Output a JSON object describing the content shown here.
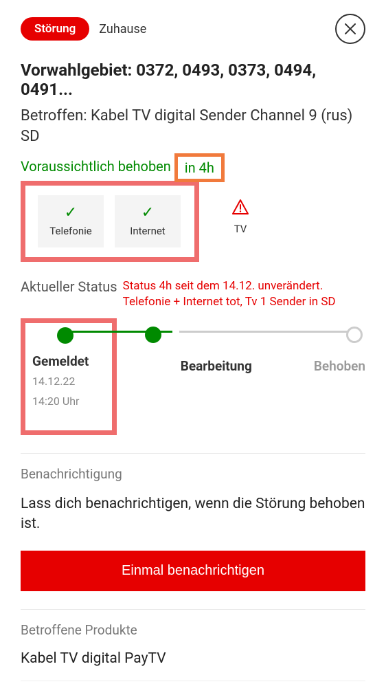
{
  "header": {
    "badge": "Störung",
    "crumb": "Zuhause"
  },
  "title": "Vorwahlgebiet: 0372, 0493, 0373, 0494, 0491...",
  "subtitle": "Betroffen: Kabel TV digital Sender Channel 9 (rus) SD",
  "eta": {
    "label": "Voraussichtlich behoben",
    "value": "in 4h"
  },
  "tiles": {
    "telephony": "Telefonie",
    "internet": "Internet",
    "tv": "TV"
  },
  "status": {
    "heading": "Aktueller Status",
    "user_annotation": "Status 4h seit dem 14.12. unverändert.\nTelefonie + Internet tot, Tv 1 Sender in SD",
    "steps": {
      "reported": {
        "label": "Gemeldet",
        "date": "14.12.22",
        "time": "14:20 Uhr"
      },
      "processing": {
        "label": "Bearbeitung"
      },
      "resolved": {
        "label": "Behoben"
      }
    }
  },
  "notification": {
    "heading": "Benachrichtigung",
    "body": "Lass dich benachrichtigen, wenn die Störung behoben ist.",
    "button": "Einmal benachrichtigen"
  },
  "products": {
    "heading": "Betroffene Produkte",
    "item1": "Kabel TV digital PayTV"
  }
}
